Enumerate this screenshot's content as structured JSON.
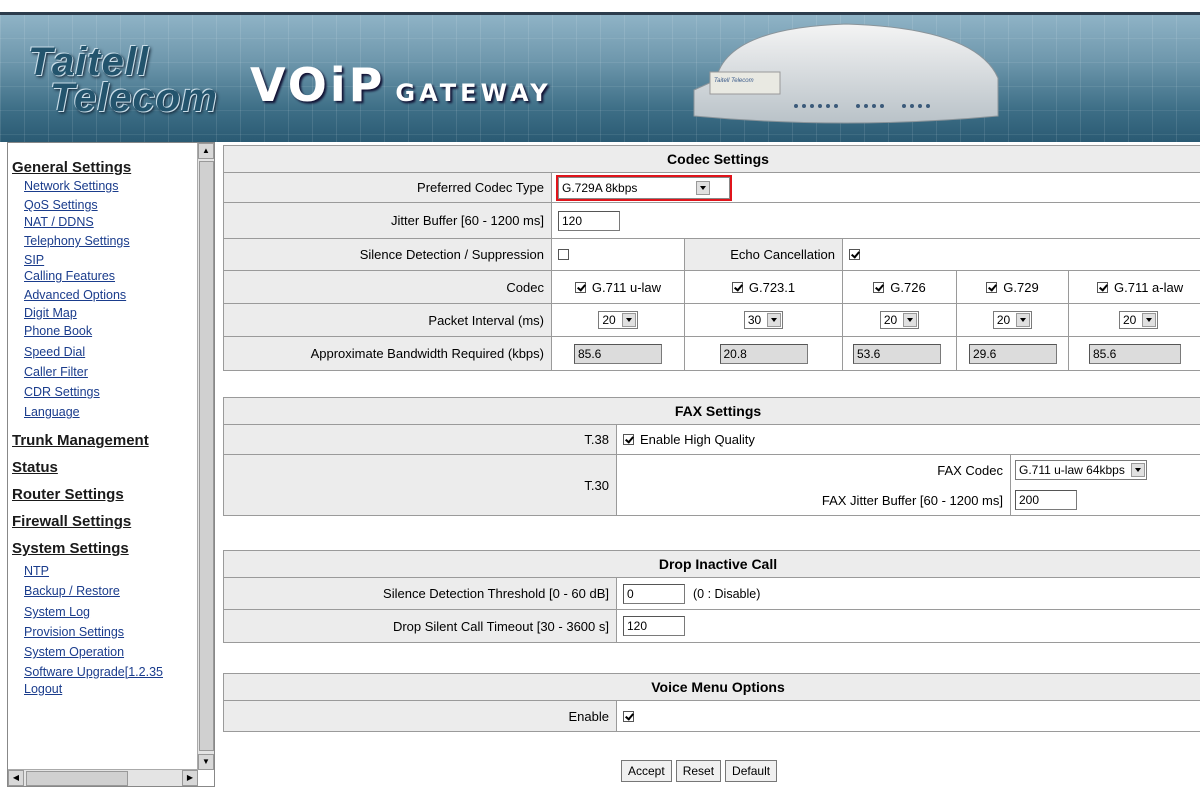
{
  "header": {
    "brand_line1": "Taitell",
    "brand_line2": "Telecom",
    "product_main": "VOiP",
    "product_sub": "GATEWAY",
    "device_label": "Taitell Telecom"
  },
  "sidebar": {
    "general_settings": {
      "heading": "General Settings",
      "items": [
        "Network Settings",
        "QoS Settings",
        "NAT / DDNS",
        "Telephony Settings",
        "SIP",
        "Calling Features",
        "Advanced Options",
        "Digit Map",
        "Phone Book",
        "Speed Dial",
        "Caller Filter",
        "CDR Settings",
        "Language"
      ]
    },
    "trunk_management": "Trunk Management",
    "status": "Status",
    "router_settings": "Router Settings",
    "firewall_settings": "Firewall Settings",
    "system_settings": {
      "heading": "System Settings",
      "items": [
        "NTP",
        "Backup / Restore",
        "System Log",
        "Provision Settings",
        "System Operation",
        "Software Upgrade[1.2.35",
        "Logout"
      ]
    }
  },
  "codec": {
    "title": "Codec Settings",
    "preferred_label": "Preferred Codec Type",
    "preferred_value": "G.729A 8kbps",
    "jitter_label": "Jitter Buffer [60 - 1200 ms]",
    "jitter_value": "120",
    "silence_label": "Silence Detection / Suppression",
    "silence_checked": false,
    "echo_label": "Echo Cancellation",
    "echo_checked": true,
    "codec_label": "Codec",
    "codecs": [
      {
        "name": "G.711 u-law",
        "checked": true,
        "interval": "20",
        "bandwidth": "85.6"
      },
      {
        "name": "G.723.1",
        "checked": true,
        "interval": "30",
        "bandwidth": "20.8"
      },
      {
        "name": "G.726",
        "checked": true,
        "interval": "20",
        "bandwidth": "53.6"
      },
      {
        "name": "G.729",
        "checked": true,
        "interval": "20",
        "bandwidth": "29.6"
      },
      {
        "name": "G.711 a-law",
        "checked": true,
        "interval": "20",
        "bandwidth": "85.6"
      }
    ],
    "interval_label": "Packet Interval (ms)",
    "bandwidth_label": "Approximate Bandwidth Required (kbps)"
  },
  "fax": {
    "title": "FAX Settings",
    "t38_label": "T.38",
    "t38_option": "Enable High Quality",
    "t38_checked": true,
    "t30_label": "T.30",
    "fax_codec_label": "FAX Codec",
    "fax_codec_value": "G.711 u-law 64kbps",
    "fax_jitter_label": "FAX Jitter Buffer [60 - 1200 ms]",
    "fax_jitter_value": "200"
  },
  "drop": {
    "title": "Drop Inactive Call",
    "threshold_label": "Silence Detection Threshold [0 - 60 dB]",
    "threshold_value": "0",
    "threshold_hint": "(0 : Disable)",
    "timeout_label": "Drop Silent Call Timeout [30 - 3600 s]",
    "timeout_value": "120"
  },
  "voice_menu": {
    "title": "Voice Menu Options",
    "enable_label": "Enable",
    "enable_checked": true
  },
  "actions": {
    "accept": "Accept",
    "reset": "Reset",
    "default": "Default"
  },
  "colors": {
    "highlight": "#e0141b",
    "link": "#1a3c8c",
    "label_bg": "#ececec"
  }
}
